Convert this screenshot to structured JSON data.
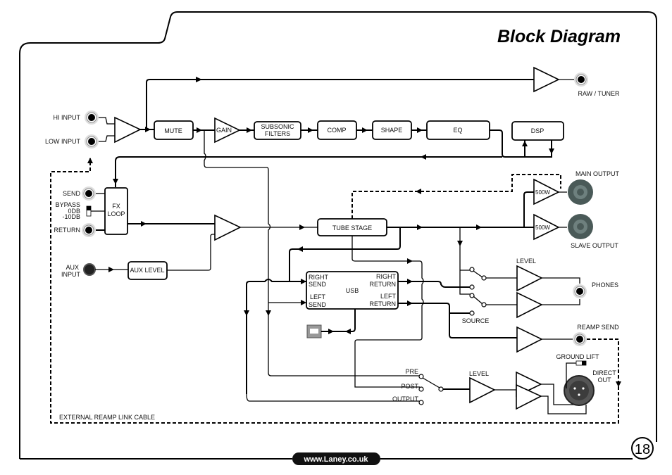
{
  "page": {
    "title": "Block Diagram",
    "page_number": "18",
    "footer_url": "www.Laney.co.uk"
  },
  "inputs": {
    "hi_input": "HI INPUT",
    "low_input": "LOW INPUT",
    "aux_input_line1": "AUX",
    "aux_input_line2": "INPUT"
  },
  "blocks": {
    "mute": "MUTE",
    "gain": "GAIN",
    "subsonic_line1": "SUBSONIC",
    "subsonic_line2": "FILTERS",
    "comp": "COMP",
    "shape": "SHAPE",
    "eq": "EQ",
    "dsp": "DSP",
    "fx_loop_line1": "FX",
    "fx_loop_line2": "LOOP",
    "aux_level": "AUX LEVEL",
    "tube_stage": "TUBE STAGE",
    "usb": "USB",
    "right_send_1": "RIGHT",
    "right_send_2": "SEND",
    "left_send_1": "LEFT",
    "left_send_2": "SEND",
    "right_return_1": "RIGHT",
    "right_return_2": "RETURN",
    "left_return_1": "LEFT",
    "left_return_2": "RETURN",
    "power_amp_main": "500W",
    "power_amp_slave": "500W"
  },
  "fx_loop": {
    "send": "SEND",
    "bypass": "BYPASS",
    "zero_db": "0DB",
    "minus_ten_db": "-10DB",
    "return": "RETURN"
  },
  "outputs": {
    "raw_tuner": "RAW / TUNER",
    "main_output": "MAIN OUTPUT",
    "slave_output": "SLAVE  OUTPUT",
    "phones": "PHONES",
    "phones_level": "LEVEL",
    "source": "SOURCE",
    "reamp_send": "REAMP SEND",
    "ground_lift": "GROUND LIFT",
    "direct_out_line1": "DIRECT",
    "direct_out_line2": "OUT",
    "direct_level": "LEVEL"
  },
  "direct_selector": {
    "pre": "PRE",
    "post": "POST",
    "output": "OUTPUT"
  },
  "cable": {
    "external_reamp": "EXTERNAL REAMP LINK CABLE"
  },
  "colors": {
    "speakon": "#4a5a58",
    "jack_ring": "#c8c8c8",
    "xlr": "#555555"
  }
}
